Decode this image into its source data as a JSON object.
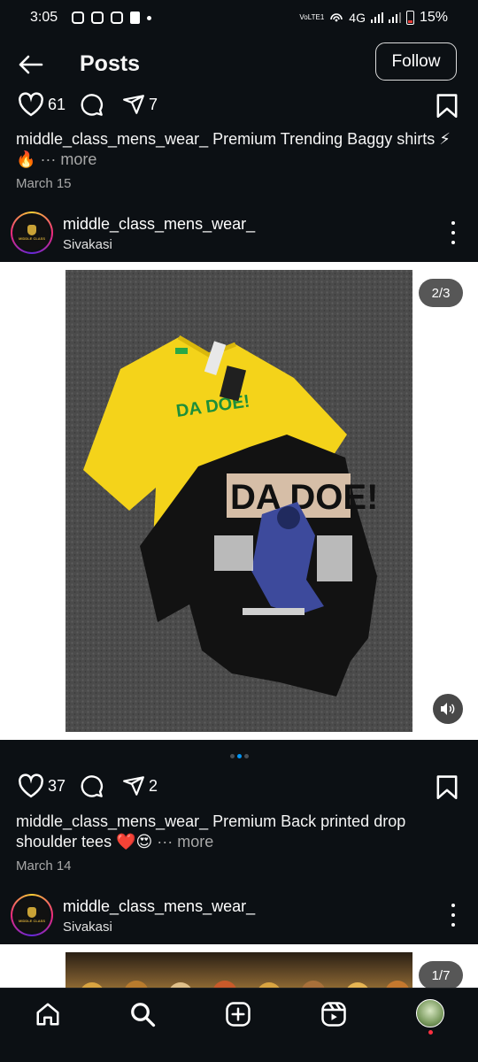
{
  "status_bar": {
    "time": "3:05",
    "network": "4G",
    "battery": "15%",
    "carrier_tag": "VoLTE1"
  },
  "header": {
    "title": "Posts",
    "follow_label": "Follow"
  },
  "posts": [
    {
      "likes": "61",
      "shares": "7",
      "username": "middle_class_mens_wear_",
      "caption_text": "Premium Trending Baggy shirts ⚡🔥",
      "more_label": "··· more",
      "date": "March 15"
    },
    {
      "username": "middle_class_mens_wear_",
      "location": "Sivakasi",
      "avatar_text": "MIDDLE CLASS",
      "image_text": "DA DOE!",
      "counter": "2/3",
      "carousel": {
        "count": 3,
        "active_index": 1
      },
      "likes": "37",
      "shares": "2",
      "caption_text": "Premium Back printed drop shoulder tees ❤️😍",
      "more_label": "··· more",
      "date": "March 14"
    },
    {
      "username": "middle_class_mens_wear_",
      "location": "Sivakasi",
      "avatar_text": "MIDDLE CLASS",
      "counter": "1/7"
    }
  ],
  "nav": {
    "items": [
      "home-icon",
      "search-icon",
      "create-icon",
      "reels-icon",
      "profile-avatar"
    ]
  },
  "colors": {
    "background": "#0c1014",
    "accent": "#0095f6",
    "like_red": "#ed4956",
    "muted_text": "#a8a8a8"
  }
}
